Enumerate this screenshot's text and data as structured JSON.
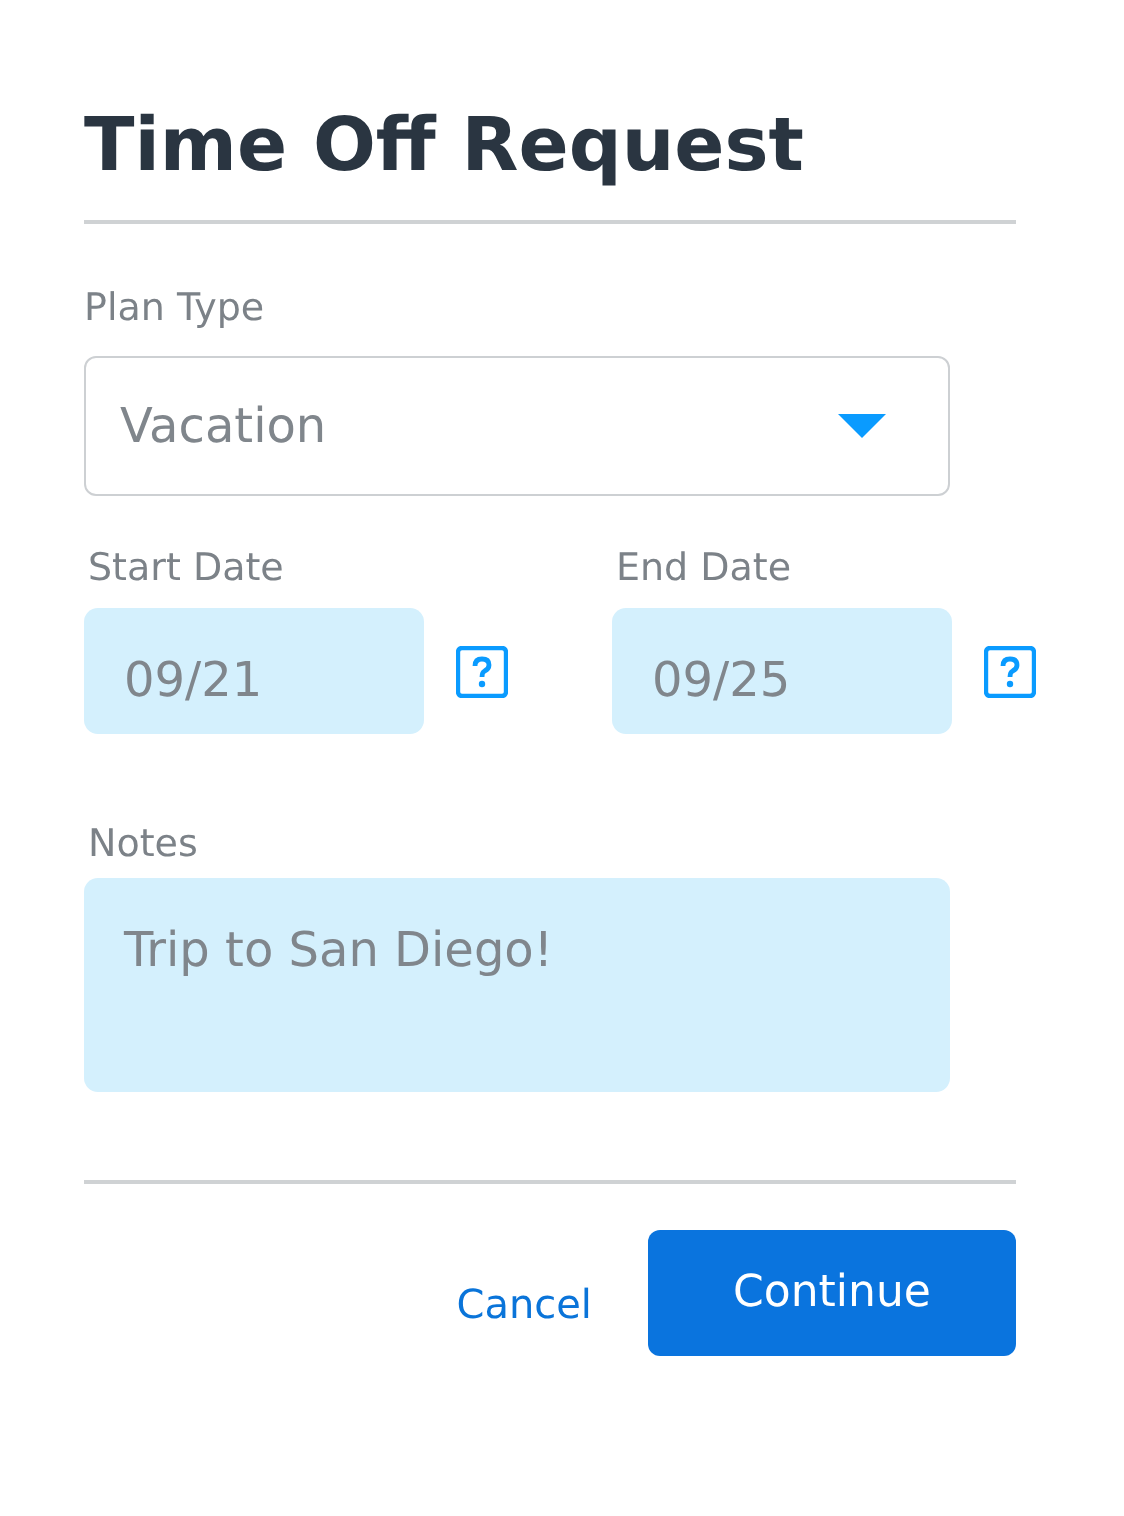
{
  "title": "Time Off Request",
  "plan_type": {
    "label": "Plan Type",
    "value": "Vacation"
  },
  "dates": [
    {
      "label": "Start Date",
      "value": "09/21"
    },
    {
      "label": "End Date",
      "value": "09/25"
    }
  ],
  "notes": {
    "label": "Notes",
    "value": "Trip to San Diego!"
  },
  "buttons": [
    {
      "kind": "link",
      "label": "Cancel"
    },
    {
      "kind": "primary",
      "label": "Continue"
    }
  ]
}
